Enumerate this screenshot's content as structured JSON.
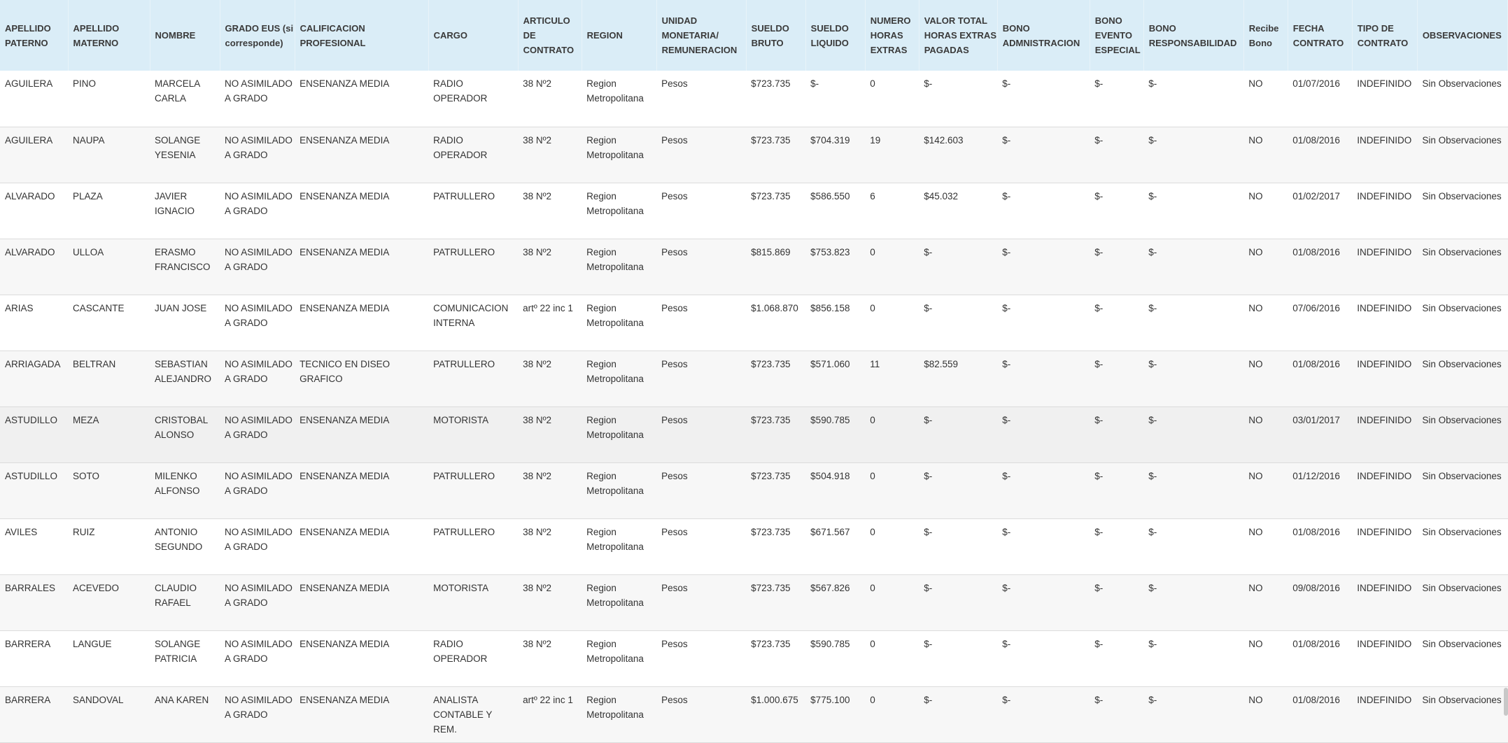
{
  "columns": [
    "APELLIDO PATERNO",
    "APELLIDO MATERNO",
    "NOMBRE",
    "GRADO EUS (si corresponde)",
    "CALIFICACION PROFESIONAL",
    "CARGO",
    "ARTICULO DE CONTRATO",
    "REGION",
    "UNIDAD MONETARIA/ REMUNERACION",
    "SUELDO BRUTO",
    "SUELDO LIQUIDO",
    "NUMERO HORAS EXTRAS",
    "VALOR TOTAL HORAS EXTRAS PAGADAS",
    "BONO ADMNISTRACION",
    "BONO EVENTO ESPECIAL",
    "BONO RESPONSABILIDAD",
    "Recibe Bono",
    "FECHA CONTRATO",
    "TIPO DE CONTRATO",
    "OBSERVACIONES"
  ],
  "rows": [
    [
      "AGUILERA",
      "PINO",
      "MARCELA CARLA",
      "NO ASIMILADO A GRADO",
      "ENSENANZA MEDIA",
      "RADIO OPERADOR",
      "38 Nº2",
      "Region Metropolitana",
      "Pesos",
      "$723.735",
      "$-",
      "0",
      "$-",
      "$-",
      "$-",
      "$-",
      "NO",
      "01/07/2016",
      "INDEFINIDO",
      "Sin Observaciones"
    ],
    [
      "AGUILERA",
      "NAUPA",
      "SOLANGE YESENIA",
      "NO ASIMILADO A GRADO",
      "ENSENANZA MEDIA",
      "RADIO OPERADOR",
      "38 Nº2",
      "Region Metropolitana",
      "Pesos",
      "$723.735",
      "$704.319",
      "19",
      "$142.603",
      "$-",
      "$-",
      "$-",
      "NO",
      "01/08/2016",
      "INDEFINIDO",
      "Sin Observaciones"
    ],
    [
      "ALVARADO",
      "PLAZA",
      "JAVIER IGNACIO",
      "NO ASIMILADO A GRADO",
      "ENSENANZA MEDIA",
      "PATRULLERO",
      "38 Nº2",
      "Region Metropolitana",
      "Pesos",
      "$723.735",
      "$586.550",
      "6",
      "$45.032",
      "$-",
      "$-",
      "$-",
      "NO",
      "01/02/2017",
      "INDEFINIDO",
      "Sin Observaciones"
    ],
    [
      "ALVARADO",
      "ULLOA",
      "ERASMO FRANCISCO",
      "NO ASIMILADO A GRADO",
      "ENSENANZA MEDIA",
      "PATRULLERO",
      "38 Nº2",
      "Region Metropolitana",
      "Pesos",
      "$815.869",
      "$753.823",
      "0",
      "$-",
      "$-",
      "$-",
      "$-",
      "NO",
      "01/08/2016",
      "INDEFINIDO",
      "Sin Observaciones"
    ],
    [
      "ARIAS",
      "CASCANTE",
      "JUAN JOSE",
      "NO ASIMILADO A GRADO",
      "ENSENANZA MEDIA",
      "COMUNICACION INTERNA",
      "artº 22 inc 1",
      "Region Metropolitana",
      "Pesos",
      "$1.068.870",
      "$856.158",
      "0",
      "$-",
      "$-",
      "$-",
      "$-",
      "NO",
      "07/06/2016",
      "INDEFINIDO",
      "Sin Observaciones"
    ],
    [
      "ARRIAGADA",
      "BELTRAN",
      "SEBASTIAN ALEJANDRO",
      "NO ASIMILADO A GRADO",
      "TECNICO EN DISEO GRAFICO",
      "PATRULLERO",
      "38 Nº2",
      "Region Metropolitana",
      "Pesos",
      "$723.735",
      "$571.060",
      "11",
      "$82.559",
      "$-",
      "$-",
      "$-",
      "NO",
      "01/08/2016",
      "INDEFINIDO",
      "Sin Observaciones"
    ],
    [
      "ASTUDILLO",
      "MEZA",
      "CRISTOBAL ALONSO",
      "NO ASIMILADO A GRADO",
      "ENSENANZA MEDIA",
      "MOTORISTA",
      "38 Nº2",
      "Region Metropolitana",
      "Pesos",
      "$723.735",
      "$590.785",
      "0",
      "$-",
      "$-",
      "$-",
      "$-",
      "NO",
      "03/01/2017",
      "INDEFINIDO",
      "Sin Observaciones"
    ],
    [
      "ASTUDILLO",
      "SOTO",
      "MILENKO ALFONSO",
      "NO ASIMILADO A GRADO",
      "ENSENANZA MEDIA",
      "PATRULLERO",
      "38 Nº2",
      "Region Metropolitana",
      "Pesos",
      "$723.735",
      "$504.918",
      "0",
      "$-",
      "$-",
      "$-",
      "$-",
      "NO",
      "01/12/2016",
      "INDEFINIDO",
      "Sin Observaciones"
    ],
    [
      "AVILES",
      "RUIZ",
      "ANTONIO SEGUNDO",
      "NO ASIMILADO A GRADO",
      "ENSENANZA MEDIA",
      "PATRULLERO",
      "38 Nº2",
      "Region Metropolitana",
      "Pesos",
      "$723.735",
      "$671.567",
      "0",
      "$-",
      "$-",
      "$-",
      "$-",
      "NO",
      "01/08/2016",
      "INDEFINIDO",
      "Sin Observaciones"
    ],
    [
      "BARRALES",
      "ACEVEDO",
      "CLAUDIO RAFAEL",
      "NO ASIMILADO A GRADO",
      "ENSENANZA MEDIA",
      "MOTORISTA",
      "38 Nº2",
      "Region Metropolitana",
      "Pesos",
      "$723.735",
      "$567.826",
      "0",
      "$-",
      "$-",
      "$-",
      "$-",
      "NO",
      "09/08/2016",
      "INDEFINIDO",
      "Sin Observaciones"
    ],
    [
      "BARRERA",
      "LANGUE",
      "SOLANGE PATRICIA",
      "NO ASIMILADO A GRADO",
      "ENSENANZA MEDIA",
      "RADIO OPERADOR",
      "38 Nº2",
      "Region Metropolitana",
      "Pesos",
      "$723.735",
      "$590.785",
      "0",
      "$-",
      "$-",
      "$-",
      "$-",
      "NO",
      "01/08/2016",
      "INDEFINIDO",
      "Sin Observaciones"
    ],
    [
      "BARRERA",
      "SANDOVAL",
      "ANA KAREN",
      "NO ASIMILADO A GRADO",
      "ENSENANZA MEDIA",
      "ANALISTA CONTABLE Y REM.",
      "artº 22 inc 1",
      "Region Metropolitana",
      "Pesos",
      "$1.000.675",
      "$775.100",
      "0",
      "$-",
      "$-",
      "$-",
      "$-",
      "NO",
      "01/08/2016",
      "INDEFINIDO",
      "Sin Observaciones"
    ]
  ]
}
